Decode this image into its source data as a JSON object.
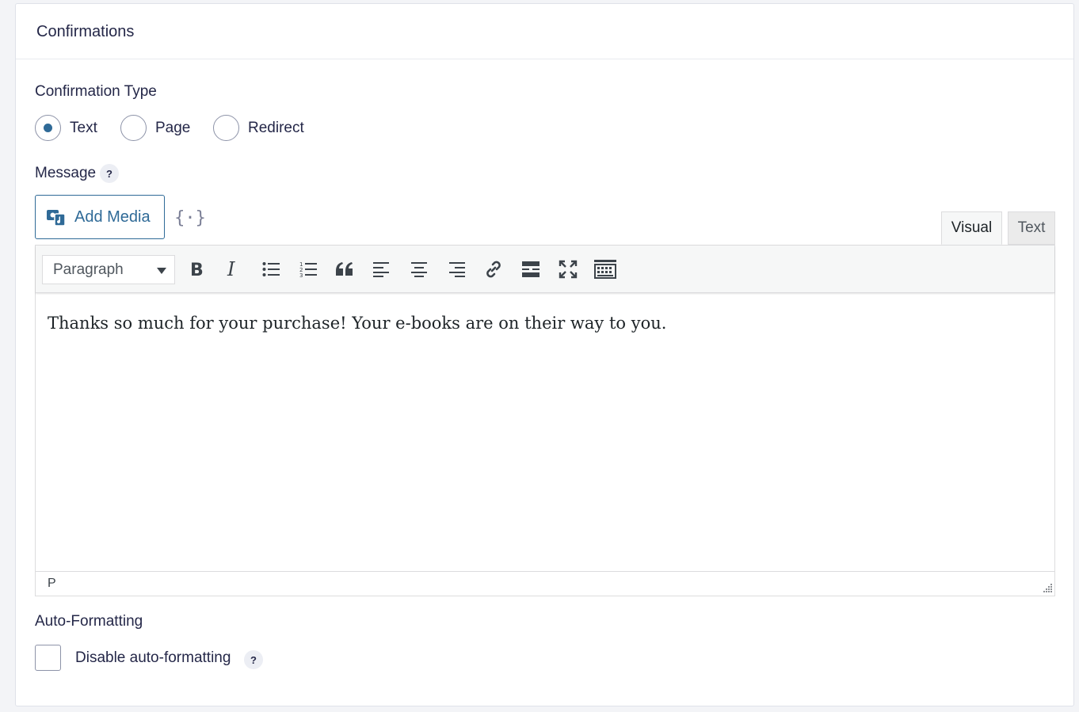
{
  "card": {
    "title": "Confirmations"
  },
  "confirmation_type": {
    "label": "Confirmation Type",
    "options": [
      {
        "label": "Text",
        "checked": true
      },
      {
        "label": "Page",
        "checked": false
      },
      {
        "label": "Redirect",
        "checked": false
      }
    ]
  },
  "message": {
    "label": "Message",
    "help": "?",
    "add_media_label": "Add Media",
    "merge_tag_icon": "merge-tags-icon",
    "tabs": {
      "visual": "Visual",
      "text": "Text"
    },
    "format_select_value": "Paragraph",
    "toolbar_icons": [
      "bold-icon",
      "italic-icon",
      "bullet-list-icon",
      "numbered-list-icon",
      "blockquote-icon",
      "align-left-icon",
      "align-center-icon",
      "align-right-icon",
      "link-icon",
      "read-more-icon",
      "fullscreen-icon",
      "toolbar-toggle-icon"
    ],
    "content": "Thanks so much for your purchase! Your e-books are on their way to you.",
    "path": "P"
  },
  "auto_formatting": {
    "label": "Auto-Formatting",
    "checkbox_label": "Disable auto-formatting",
    "checked": false,
    "help": "?"
  },
  "colors": {
    "accent": "#2f6a97",
    "text": "#242748",
    "border": "#dfe2e9"
  }
}
